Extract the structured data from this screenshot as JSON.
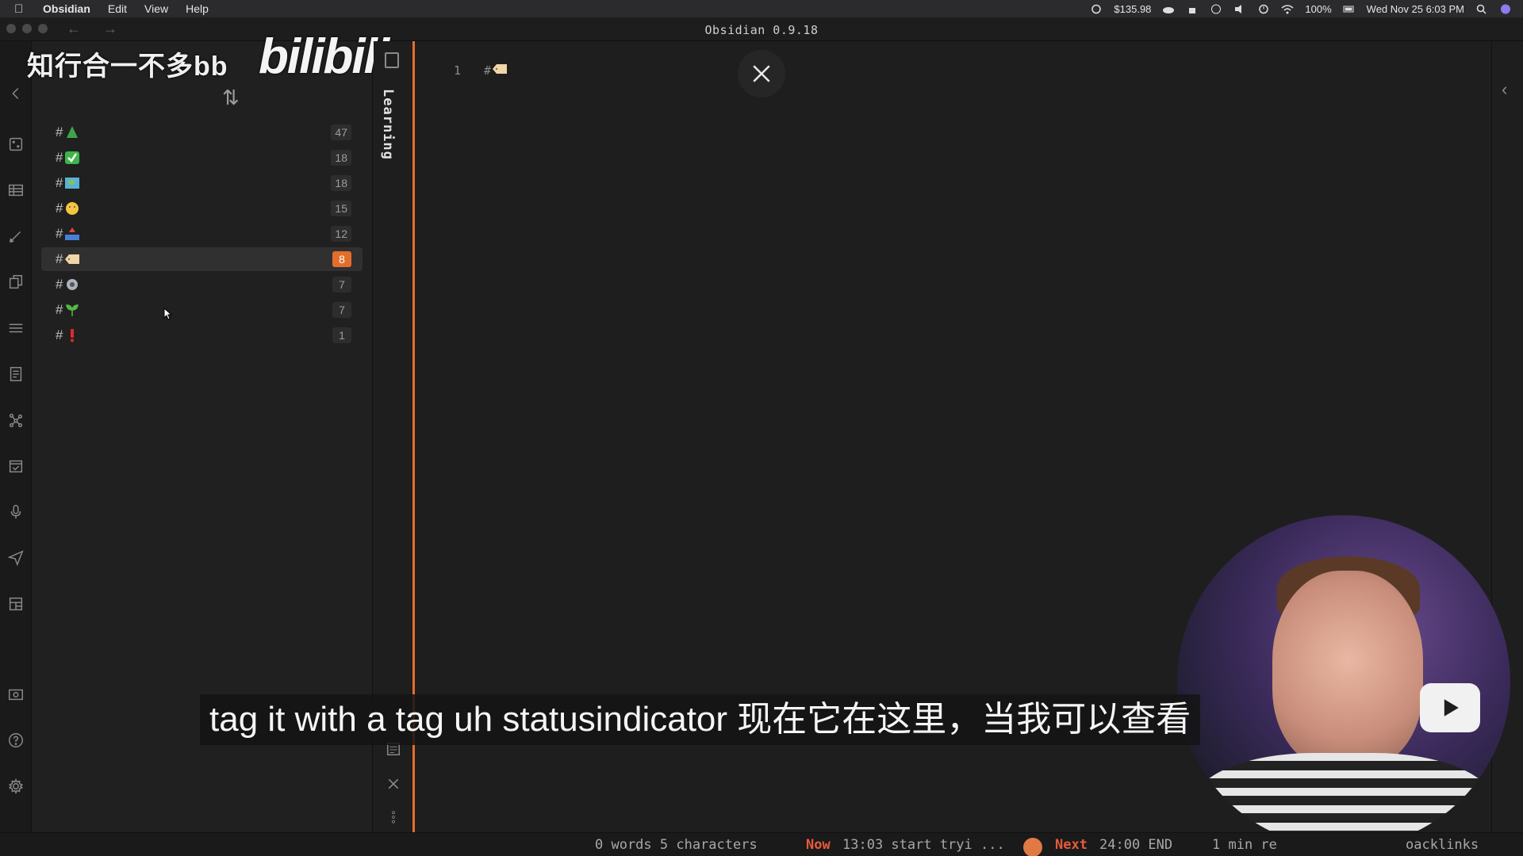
{
  "menubar": {
    "app": "Obsidian",
    "items": [
      "Edit",
      "View",
      "Help"
    ],
    "price": "$135.98",
    "battery": "100%",
    "datetime": "Wed Nov 25  6:03 PM"
  },
  "window": {
    "title": "Obsidian 0.9.18"
  },
  "watermark": {
    "text": "知行合一不多bb",
    "logo": "bilibili"
  },
  "tags": [
    {
      "emoji": "tree-icon",
      "count": "47"
    },
    {
      "emoji": "check-mark-button-icon",
      "count": "18"
    },
    {
      "emoji": "map-icon",
      "count": "18"
    },
    {
      "emoji": "face-icon",
      "count": "15"
    },
    {
      "emoji": "inbox-tray-icon",
      "count": "12"
    },
    {
      "emoji": "label-tag-icon",
      "count": "8",
      "selected": true
    },
    {
      "emoji": "gear-icon",
      "count": "7"
    },
    {
      "emoji": "seedling-icon",
      "count": "7"
    },
    {
      "emoji": "exclamation-icon",
      "count": "1"
    }
  ],
  "tab": {
    "label": "Learning"
  },
  "editor": {
    "line_number": "1",
    "line_prefix": "#"
  },
  "subtitle": "tag it with a tag uh statusindicator 现在它在这里，当我可以查看",
  "statusbar": {
    "words": "0 words 5 characters",
    "now_label": "Now",
    "now_text": "13:03 start tryi ...",
    "next_label": "Next",
    "next_text": "24:00 END",
    "read_time": "1 min re",
    "backlinks": "oacklinks"
  },
  "colors": {
    "accent": "#e36e2c",
    "background": "#1e1e1e"
  }
}
